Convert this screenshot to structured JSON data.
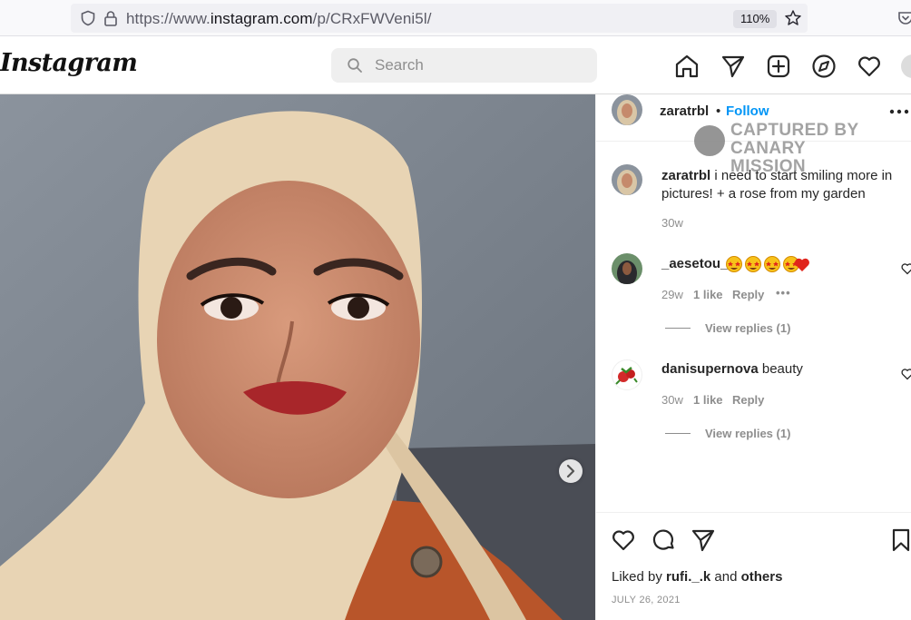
{
  "browser": {
    "url_prefix": "https://www.",
    "url_domain": "instagram.com",
    "url_path": "/p/CRxFWVeni5l/",
    "zoom": "110%"
  },
  "header": {
    "logo": "Instagram",
    "search_placeholder": "Search",
    "icons": [
      "home-icon",
      "direct-icon",
      "new-post-icon",
      "explore-icon",
      "activity-icon",
      "avatar"
    ]
  },
  "post": {
    "author": "zaratrbl",
    "follow_label": "Follow",
    "separator": "•",
    "watermark_line1": "CAPTURED BY",
    "watermark_line2": "CANARY MISSION",
    "caption_user": "zaratrbl",
    "caption_text": " i need to start smiling more in pictures! + a rose from my garden",
    "caption_age": "30w",
    "comments": [
      {
        "user": "_aesetou_",
        "text": "",
        "emojis": [
          "star-eyes-emoji",
          "star-eyes-emoji",
          "star-eyes-emoji",
          "star-eyes-emoji",
          "red-heart-emoji"
        ],
        "age": "29w",
        "likes": "1 like",
        "reply": "Reply",
        "more": "•••",
        "view_replies": "View replies (1)"
      },
      {
        "user": "danisupernova",
        "text": " beauty",
        "age": "30w",
        "likes": "1 like",
        "reply": "Reply",
        "view_replies": "View replies (1)"
      }
    ],
    "liked_by_prefix": "Liked by ",
    "liked_by_user": "rufi._.k",
    "liked_by_mid": " and ",
    "liked_by_others": "others",
    "date": "JULY 26, 2021"
  },
  "colors": {
    "link_blue": "#0095f6",
    "muted": "#8e8e8e",
    "text": "#262626"
  }
}
